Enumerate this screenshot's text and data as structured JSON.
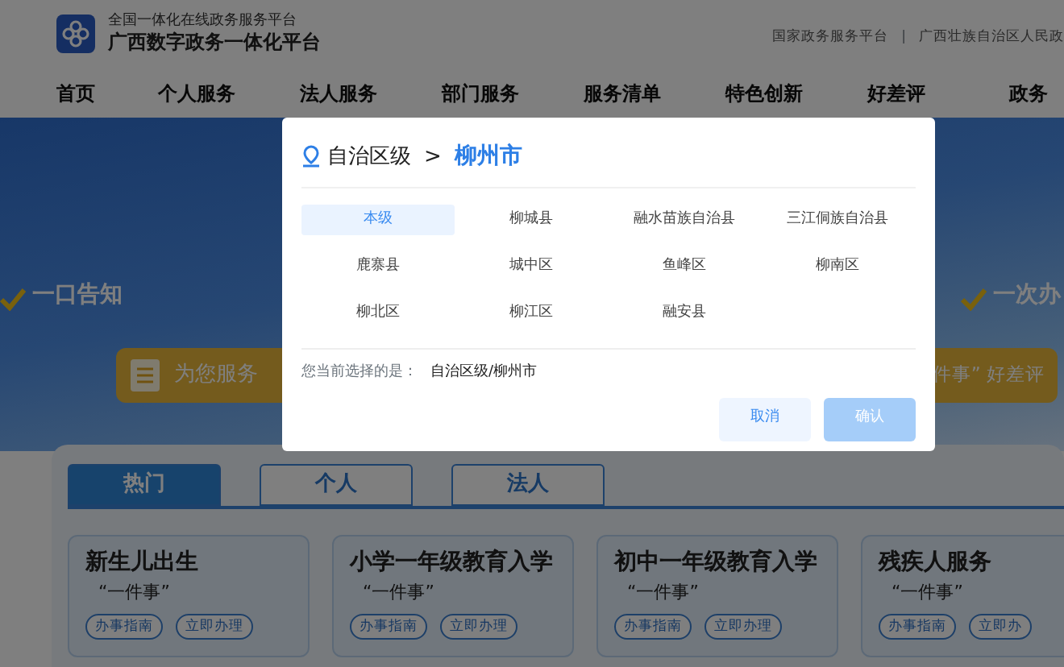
{
  "header": {
    "subtitle": "全国一体化在线政务服务平台",
    "title": "广西数字政务一体化平台",
    "links": [
      "国家政务服务平台",
      "广西壮族自治区人民政"
    ],
    "link_separator": "|"
  },
  "nav": [
    {
      "label": "首页"
    },
    {
      "label": "个人服务"
    },
    {
      "label": "法人服务"
    },
    {
      "label": "部门服务"
    },
    {
      "label": "服务清单"
    },
    {
      "label": "特色创新"
    },
    {
      "label": "好差评"
    },
    {
      "label": "政务"
    }
  ],
  "banner": {
    "slogans": [
      "一口告知",
      "一次办"
    ],
    "service_pill": {
      "left": "为您服务",
      "right": "件事” 好差评"
    }
  },
  "service_tabs": [
    {
      "label": "热门",
      "selected": true
    },
    {
      "label": "个人",
      "selected": false
    },
    {
      "label": "法人",
      "selected": false
    }
  ],
  "cards": [
    {
      "title": "新生儿出生",
      "subtitle": "“一件事”",
      "buttons": [
        "办事指南",
        "立即办理"
      ]
    },
    {
      "title": "小学一年级教育入学",
      "subtitle": "“一件事”",
      "buttons": [
        "办事指南",
        "立即办理"
      ]
    },
    {
      "title": "初中一年级教育入学",
      "subtitle": "“一件事”",
      "buttons": [
        "办事指南",
        "立即办理"
      ]
    },
    {
      "title": "残疾人服务",
      "subtitle": "“一件事”",
      "buttons": [
        "办事指南",
        "立即办"
      ]
    }
  ],
  "region_dialog": {
    "breadcrumb": {
      "parent": "自治区级",
      "separator": ">",
      "current": "柳州市"
    },
    "options": [
      {
        "label": "本级",
        "selected": true
      },
      {
        "label": "柳城县",
        "selected": false
      },
      {
        "label": "融水苗族自治县",
        "selected": false
      },
      {
        "label": "三江侗族自治县",
        "selected": false
      },
      {
        "label": "鹿寨县",
        "selected": false
      },
      {
        "label": "城中区",
        "selected": false
      },
      {
        "label": "鱼峰区",
        "selected": false
      },
      {
        "label": "柳南区",
        "selected": false
      },
      {
        "label": "柳北区",
        "selected": false
      },
      {
        "label": "柳江区",
        "selected": false
      },
      {
        "label": "融安县",
        "selected": false
      }
    ],
    "current_label": "您当前选择的是：",
    "current_value": "自治区级/柳州市",
    "buttons": [
      {
        "label": "取消",
        "kind": "cancel",
        "disabled": false
      },
      {
        "label": "确认",
        "kind": "confirm",
        "disabled": true
      }
    ]
  }
}
